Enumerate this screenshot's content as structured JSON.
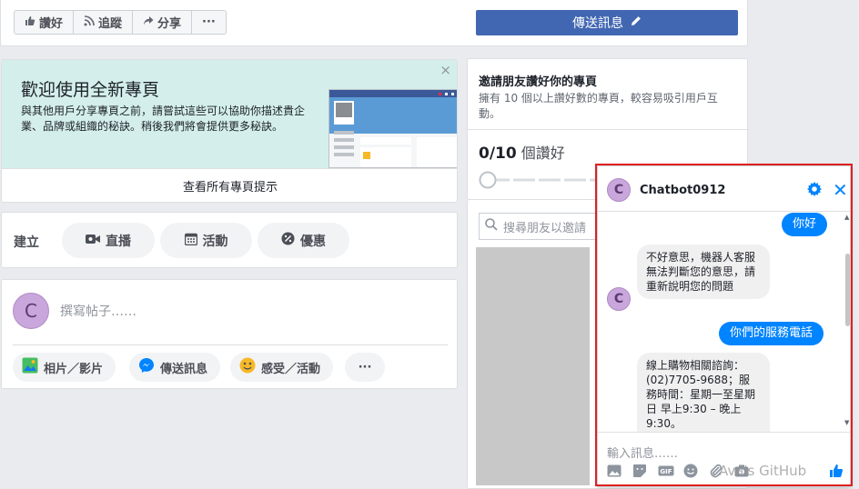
{
  "topbar": {
    "like_label": "讚好",
    "follow_label": "追蹤",
    "share_label": "分享",
    "more_label": "···",
    "send_message_label": "傳送訊息"
  },
  "welcome": {
    "title": "歡迎使用全新專頁",
    "description": "與其他用戶分享專頁之前，請嘗試這些可以協助你描述貴企業、品牌或組織的秘訣。稍後我們將會提供更多秘訣。",
    "footer_link": "查看所有專頁提示",
    "close": "×"
  },
  "create": {
    "label": "建立",
    "live_label": "直播",
    "event_label": "活動",
    "offer_label": "優惠"
  },
  "post": {
    "avatar_letter": "C",
    "placeholder": "撰寫帖子……",
    "photo_label": "相片／影片",
    "message_label": "傳送訊息",
    "feeling_label": "感受／活動",
    "more_label": "···"
  },
  "invite": {
    "title": "邀請朋友讚好你的專頁",
    "description": "擁有 10 個以上讚好數的專頁，較容易吸引用戶互動。",
    "count": "0/10",
    "count_suffix": "個讚好",
    "search_placeholder": "搜尋朋友以邀請"
  },
  "chat": {
    "avatar_letter": "C",
    "bot_name": "Chatbot0912",
    "close": "✕",
    "messages": [
      {
        "from": "user",
        "text": "你好"
      },
      {
        "from": "bot",
        "text": "不好意思，機器人客服無法判斷您的意思，請重新說明您的問題"
      },
      {
        "from": "user",
        "text": "你們的服務電話"
      },
      {
        "from": "bot",
        "text": "線上購物相關諮詢：(02)7705-9688；服務時間：星期一至星期日 早上9:30 – 晚上9:30。"
      }
    ],
    "input_placeholder": "輸入訊息……"
  },
  "watermark": "Ava's GitHub",
  "colors": {
    "facebook_blue": "#4267b2",
    "messenger_blue": "#0084ff",
    "highlight_red": "#e02020",
    "teal_bg": "#d4efeb"
  }
}
